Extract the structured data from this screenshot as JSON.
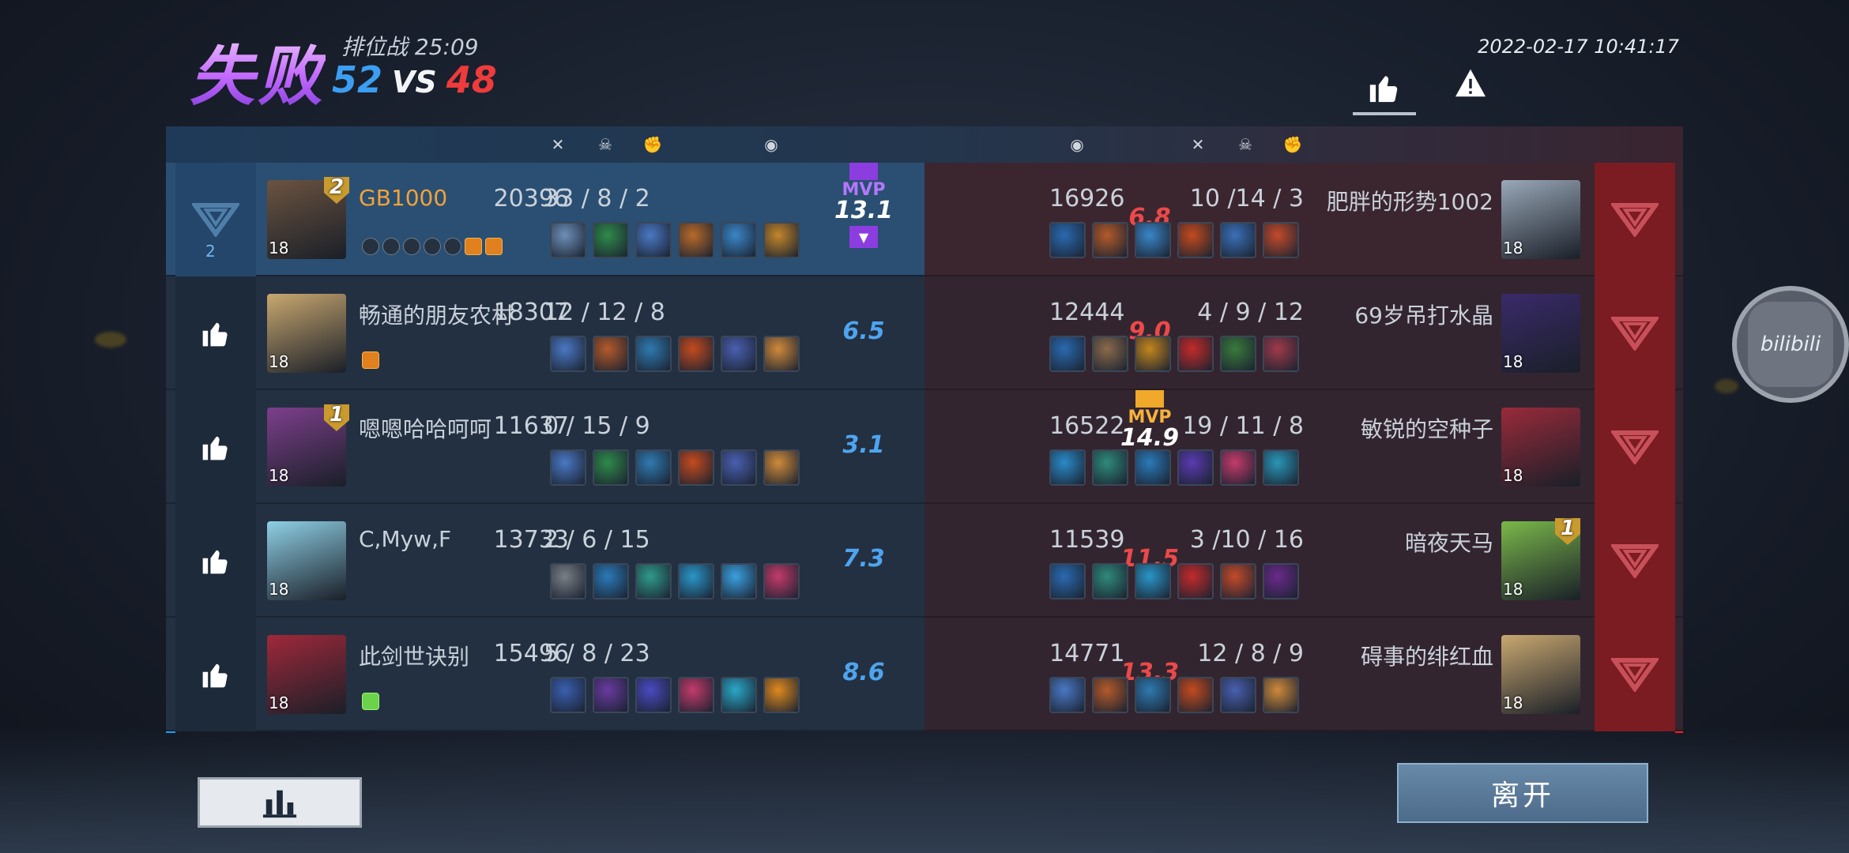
{
  "header": {
    "result": "失败",
    "mode": "排位战",
    "duration": "25:09",
    "score_blue": "52",
    "vs": "VS",
    "score_red": "48",
    "datetime": "2022-02-17 10:41:17"
  },
  "icons": {
    "top_like": "thumbs-up-icon",
    "top_report": "warning-icon",
    "kill": "crossed-swords-icon",
    "death": "skull-icon",
    "assist": "fist-icon",
    "damage": "shield-icon",
    "stats_button": "bar-chart-icon"
  },
  "blue_team": [
    {
      "name": "GB1000",
      "level": "18",
      "rank_badge": "2",
      "kda": "33 / 8 / 2",
      "damage": "20396",
      "rating": "13.1",
      "mvp": "MVP",
      "like_count": "2",
      "items": [
        "#6e8fb8",
        "#2f8a4a",
        "#4a78c4",
        "#b86a2a",
        "#3a86c8",
        "#c4862a"
      ],
      "avatar_color": "#6b5340"
    },
    {
      "name": "畅通的朋友农村",
      "level": "18",
      "rank_badge": "",
      "kda": "12 / 12 / 8",
      "damage": "18307",
      "rating": "6.5",
      "items": [
        "#4a78c4",
        "#b45a2a",
        "#2f7ab0",
        "#c44a1e",
        "#4a5fb0",
        "#d08a3a"
      ],
      "avatar_color": "#c9a870"
    },
    {
      "name": "嗯嗯哈哈呵呵",
      "level": "18",
      "rank_badge": "1",
      "kda": "0 / 15 / 9",
      "damage": "11637",
      "rating": "3.1",
      "items": [
        "#4a78c4",
        "#2f8a4a",
        "#2f7ab0",
        "#c44a1e",
        "#4a5fb0",
        "#d08a3a"
      ],
      "avatar_color": "#7d3f8c"
    },
    {
      "name": "C,Myw,F",
      "level": "18",
      "rank_badge": "",
      "kda": "2 / 6 / 15",
      "damage": "13733",
      "rating": "7.3",
      "items": [
        "#7a7f86",
        "#2a7ab8",
        "#2f9a8a",
        "#2a96c8",
        "#3aa0e0",
        "#c43a6a"
      ],
      "avatar_color": "#8fd0e6"
    },
    {
      "name": "此剑世诀别",
      "level": "18",
      "rank_badge": "",
      "kda": "5 / 8 / 23",
      "damage": "15496",
      "rating": "8.6",
      "items": [
        "#3a5fb0",
        "#6a3aa0",
        "#4a4ac0",
        "#c43a6a",
        "#2aa8c8",
        "#e08a1e"
      ],
      "avatar_color": "#a0283a"
    }
  ],
  "red_team": [
    {
      "name": "肥胖的形势1002",
      "level": "18",
      "rank_badge": "",
      "kda": "10 /14 / 3",
      "damage": "16926",
      "rating": "6.8",
      "items": [
        "#2a6ab0",
        "#b45a2a",
        "#3a86c8",
        "#c44a1e",
        "#3a70b8",
        "#c44a2a"
      ],
      "avatar_color": "#9aa8b8"
    },
    {
      "name": "69岁吊打水晶",
      "level": "18",
      "rank_badge": "",
      "kda": "4 / 9 / 12",
      "damage": "12444",
      "rating": "9.0",
      "items": [
        "#2a6ab0",
        "#8a6a4a",
        "#c4861e",
        "#c42a2a",
        "#3a7a3a",
        "#a03a4a"
      ],
      "avatar_color": "#3a2a6a"
    },
    {
      "name": "敏锐的空种子",
      "level": "18",
      "rank_badge": "",
      "kda": "19 / 11 / 8",
      "damage": "16522",
      "rating": "14.9",
      "mvp": "MVP",
      "items": [
        "#2a8ac8",
        "#2f8a7a",
        "#2a7ab8",
        "#5a3ab0",
        "#c43a6a",
        "#2a96b8"
      ],
      "avatar_color": "#9a2a3a"
    },
    {
      "name": "暗夜天马",
      "level": "18",
      "rank_badge": "1",
      "kda": "3 /10 / 16",
      "damage": "11539",
      "rating": "11.5",
      "items": [
        "#2a6ab0",
        "#2f8a7a",
        "#2a96c8",
        "#c42a2a",
        "#c44a2a",
        "#6a2a8a"
      ],
      "avatar_color": "#7ab84a"
    },
    {
      "name": "碍事的绯红血",
      "level": "18",
      "rank_badge": "",
      "kda": "12 / 8 / 9",
      "damage": "14771",
      "rating": "13.3",
      "items": [
        "#4a78c4",
        "#b45a2a",
        "#2f7ab0",
        "#c44a1e",
        "#4a5fb0",
        "#d08a3a"
      ],
      "avatar_color": "#c9a870"
    }
  ],
  "buttons": {
    "leave": "离开"
  },
  "floating": {
    "label": "bilibili"
  },
  "colors": {
    "blue_team": "#1c9df2",
    "red_team": "#ff1c1c",
    "mvp_purple": "#8c3de0",
    "mvp_gold": "#f0a92b",
    "my_name": "#f2a23a"
  }
}
